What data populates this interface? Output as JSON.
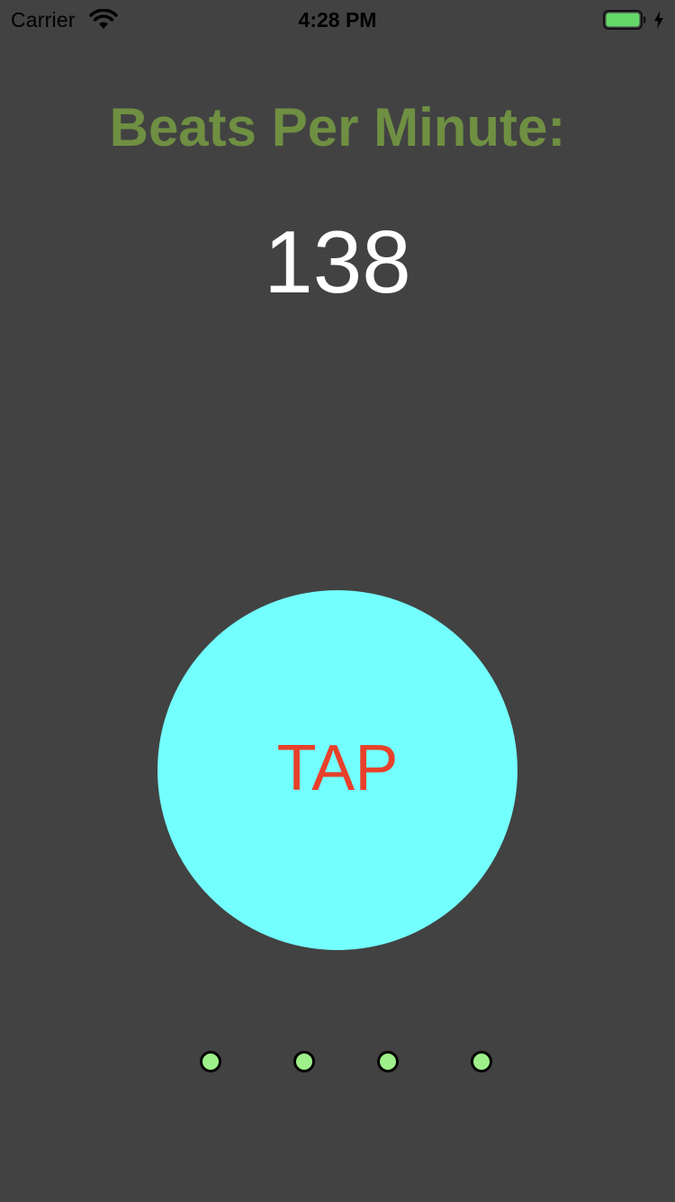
{
  "status_bar": {
    "carrier": "Carrier",
    "time": "4:28 PM",
    "signal_icon": "wifi-icon",
    "battery_icon": "battery-full-icon",
    "charging_icon": "charging-bolt-icon",
    "battery_level": 1.0
  },
  "header": {
    "title": "Beats Per Minute:"
  },
  "bpm": {
    "value": "138"
  },
  "tap_button": {
    "label": "TAP"
  },
  "beat_indicators": {
    "count": 4
  },
  "colors": {
    "background": "#424242",
    "title": "#6f8f42",
    "bpm_value": "#ffffff",
    "tap_button_fill": "#74ffff",
    "tap_label": "#e8402a",
    "indicator_fill": "#9ef08a",
    "battery_fill": "#65d86a"
  }
}
